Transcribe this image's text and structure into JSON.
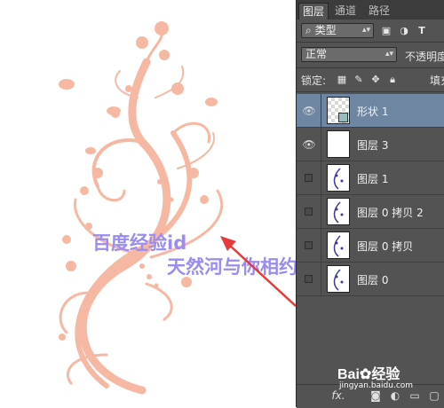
{
  "watermark": {
    "line1": "百度经验id",
    "line2": "天然河与你相约"
  },
  "panel": {
    "tabs": [
      "图层",
      "通道",
      "路径"
    ],
    "filter_label": "类型",
    "blend_mode": "正常",
    "opacity_label": "不透明度",
    "lock_label": "锁定:",
    "fill_label": "填充",
    "icon_names": [
      "image-filter-icon",
      "adjustment-filter-icon",
      "type-filter-icon",
      "lock-pixels-icon",
      "lock-brush-icon",
      "lock-position-icon",
      "lock-all-icon"
    ],
    "layers": [
      {
        "name": "形状 1",
        "visible": true,
        "selected": true,
        "thumb": "checker"
      },
      {
        "name": "图层 3",
        "visible": true,
        "selected": false,
        "thumb": "white"
      },
      {
        "name": "图层 1",
        "visible": false,
        "selected": false,
        "thumb": "pattern"
      },
      {
        "name": "图层 0 拷贝 2",
        "visible": false,
        "selected": false,
        "thumb": "pattern"
      },
      {
        "name": "图层 0 拷贝",
        "visible": false,
        "selected": false,
        "thumb": "pattern"
      },
      {
        "name": "图层 0",
        "visible": false,
        "selected": false,
        "thumb": "pattern"
      }
    ],
    "bottom_fx": "fx."
  },
  "brand": {
    "logo_text": "Bai",
    "logo_suffix": "经验",
    "url": "jingyan.baidu.com"
  },
  "colors": {
    "ornament": "#f7b8a3",
    "watermark": "#9a8cf0",
    "arrow": "#e53a3a",
    "panel_bg": "#535353",
    "selected_row": "#6f86a3"
  }
}
